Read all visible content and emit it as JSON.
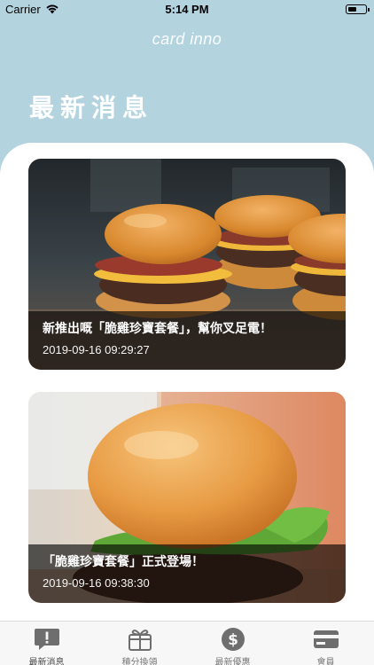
{
  "status_bar": {
    "carrier": "Carrier",
    "time": "5:14 PM",
    "icons": [
      "wifi-icon",
      "battery-icon"
    ]
  },
  "app": {
    "title": "card inno"
  },
  "page": {
    "title": "最新消息"
  },
  "news": [
    {
      "title": "新推出嘅「脆雞珍寶套餐」，幫你叉足電！",
      "date": "2019-09-16 09:29:27",
      "image": "burger-sliders-photo"
    },
    {
      "title": "「脆雞珍寶套餐」正式登場！",
      "date": "2019-09-16 09:38:30",
      "image": "burger-photo"
    }
  ],
  "tabs": [
    {
      "label": "最新消息",
      "icon": "news-alert-icon",
      "active": true
    },
    {
      "label": "積分換領",
      "icon": "gift-icon",
      "active": false
    },
    {
      "label": "最新優惠",
      "icon": "dollar-coin-icon",
      "active": false
    },
    {
      "label": "會員",
      "icon": "member-card-icon",
      "active": false
    }
  ],
  "colors": {
    "header_background": "#b3d3df",
    "panel_background": "#ffffff",
    "tab_bar_background": "#f7f7f7",
    "tab_icon": "#6e6e6e"
  }
}
